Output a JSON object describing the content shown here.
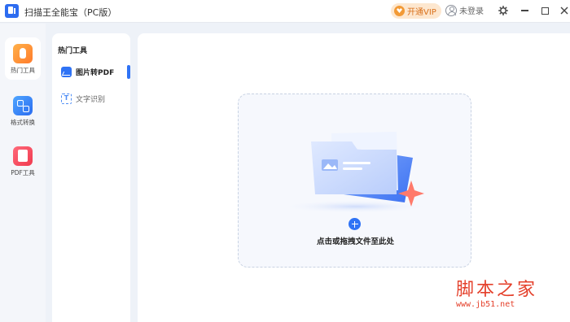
{
  "app": {
    "title": "扫描王全能宝（PC版）"
  },
  "titlebar": {
    "vip_label": "开通VIP",
    "login_label": "未登录",
    "settings_icon": "gear-icon",
    "minimize_icon": "minimize-icon",
    "maximize_icon": "maximize-icon",
    "close_icon": "close-icon",
    "vip_color": "#d9701b"
  },
  "nav": {
    "items": [
      {
        "label": "热门工具",
        "icon": "hot-tools-icon",
        "active": true
      },
      {
        "label": "格式转换",
        "icon": "format-convert-icon",
        "active": false
      },
      {
        "label": "PDF工具",
        "icon": "pdf-tools-icon",
        "active": false
      }
    ]
  },
  "tools": {
    "section_title": "热门工具",
    "items": [
      {
        "label": "图片转PDF",
        "icon": "image-to-pdf-icon",
        "active": true
      },
      {
        "label": "文字识别",
        "icon": "ocr-icon",
        "active": false
      }
    ]
  },
  "dropzone": {
    "label": "点击或拖拽文件至此处",
    "add_icon": "plus-icon",
    "accent": "#2f73f5"
  },
  "watermark": {
    "title": "脚本之家",
    "url": "www.jb51.net"
  }
}
